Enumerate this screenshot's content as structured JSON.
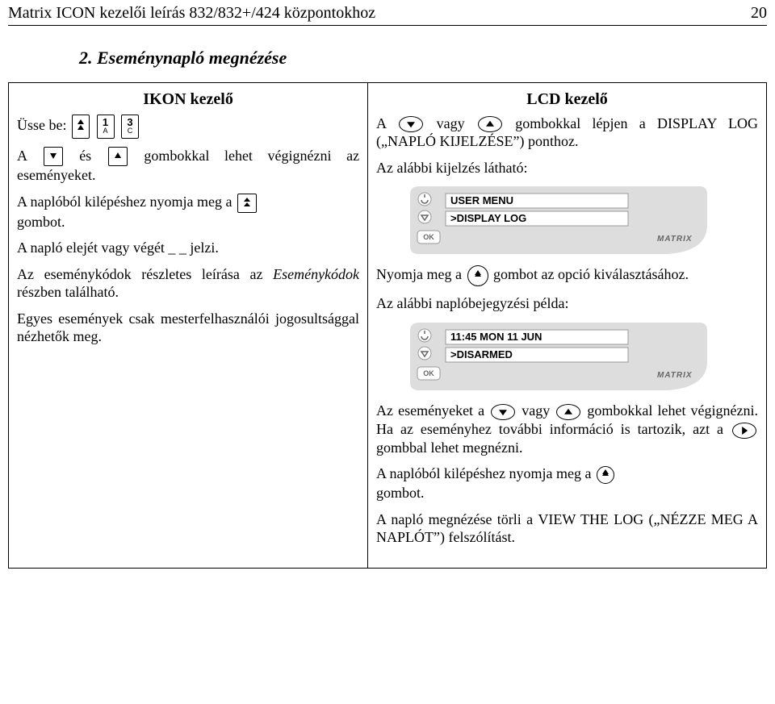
{
  "header": {
    "title": "Matrix ICON kezelői leírás 832/832+/424 központokhoz",
    "page": "20"
  },
  "section": {
    "title": "2. Eseménynapló megnézése"
  },
  "left": {
    "title": "IKON kezelő",
    "press": "Üsse be:",
    "key1": {
      "num": "1",
      "sub": "A"
    },
    "key3": {
      "num": "3",
      "sub": "C"
    },
    "seg_a": "A ",
    "seg_and": " és ",
    "seg_rest": " gombokkal lehet végignézni az eseményeket.",
    "exit_a": "A naplóból kilépéshez nyomja meg a ",
    "exit_b": "gombot.",
    "ends": "A napló elejét vagy végét _ _ jelzi.",
    "codes_a": "Az eseménykódok részletes leírása az ",
    "codes_i": "Eseménykódok",
    "codes_b": " részben található.",
    "master": "Egyes események csak mesterfelhasználói jogosultsággal nézhetők meg."
  },
  "right": {
    "title": "LCD kezelő",
    "l1_a": "A ",
    "l1_or": " vagy ",
    "l1_b": " gombokkal lépjen a ",
    "l1_disp": "DISPLAY LOG ",
    "l1_naplo": "NAPLÓ KIJELZÉSE",
    "l1_pont": " ponthoz.",
    "l2": "Az alábbi kijelzés látható:",
    "lcd1": {
      "line1": "USER MENU",
      "line2": ">DISPLAY LOG"
    },
    "lcd_brand": "MATRIX",
    "l3_a": "Nyomja meg a ",
    "l3_b": " gombot az opció kiválasz­tásához.",
    "l4": "Az alábbi naplóbejegyzési példa:",
    "lcd2": {
      "line1": "11:45 MON 11 JUN",
      "line2": ">DISARMED"
    },
    "l5_a": "Az eseményeket a ",
    "l5_or": " vagy ",
    "l5_b": " gombokkal lehet végignézni. Ha az eseményhez további információ is tartozik, azt a ",
    "l5_c": " gombbal lehet megnézni.",
    "l6_a": "A naplóból kilépéshez nyomja meg a ",
    "l6_b": "gombot.",
    "l7_a": "A napló megnézése törli a ",
    "l7_b": "VIEW THE LOG ",
    "l7_c": "NÉZZE MEG A NAPLÓT",
    "l7_d": " felszólítást."
  }
}
